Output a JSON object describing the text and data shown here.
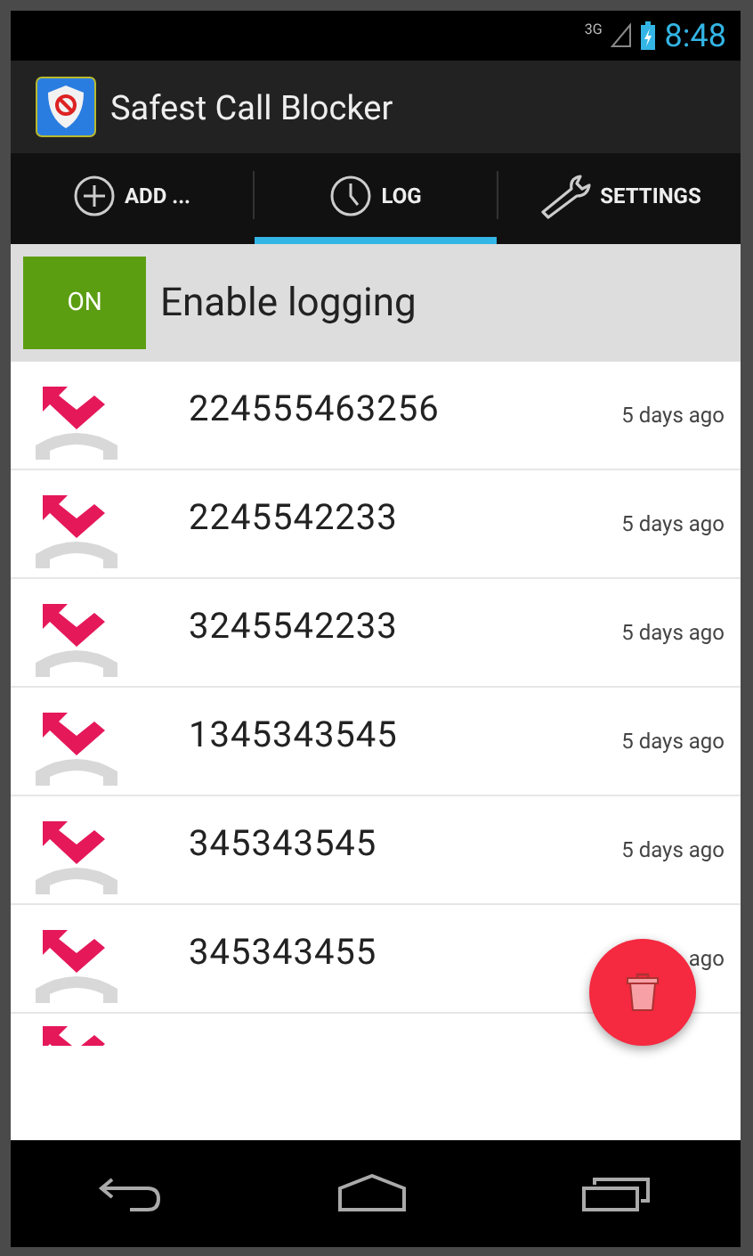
{
  "status_bar": {
    "network": "3G",
    "time": "8:48"
  },
  "app_bar": {
    "title": "Safest Call Blocker"
  },
  "tabs": [
    {
      "label": "ADD ...",
      "kind": "plus",
      "selected": false
    },
    {
      "label": "LOG",
      "kind": "clock",
      "selected": true
    },
    {
      "label": "SETTINGS",
      "kind": "wrench",
      "selected": false
    }
  ],
  "logging": {
    "switch": "ON",
    "on": true,
    "label": "Enable logging"
  },
  "calls": [
    {
      "number": "224555463256",
      "time": "5 days ago"
    },
    {
      "number": "2245542233",
      "time": "5 days ago"
    },
    {
      "number": "3245542233",
      "time": "5 days ago"
    },
    {
      "number": "1345343545",
      "time": "5 days ago"
    },
    {
      "number": "345343545",
      "time": "5 days ago"
    },
    {
      "number": "345343455",
      "time": "ago"
    }
  ]
}
